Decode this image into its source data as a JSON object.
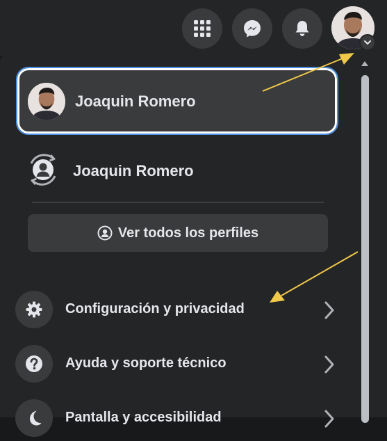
{
  "topbar": {
    "menu_icon": "grid-menu-icon",
    "messenger_icon": "messenger-icon",
    "notifications_icon": "bell-icon",
    "account_chevron_icon": "chevron-down-icon"
  },
  "profiles": {
    "current": {
      "name": "Joaquin Romero"
    },
    "other": {
      "name": "Joaquin Romero"
    },
    "see_all_label": "Ver todos los perfiles"
  },
  "menu": {
    "items": [
      {
        "label": "Configuración y privacidad",
        "icon": "gear-icon"
      },
      {
        "label": "Ayuda y soporte técnico",
        "icon": "question-icon"
      },
      {
        "label": "Pantalla y accesibilidad",
        "icon": "moon-icon"
      }
    ]
  },
  "colors": {
    "background": "#242526",
    "surface": "#3a3b3c",
    "text": "#e4e6eb",
    "highlight_border": "#ffffff",
    "annotation_arrow": "#f0c84a"
  }
}
